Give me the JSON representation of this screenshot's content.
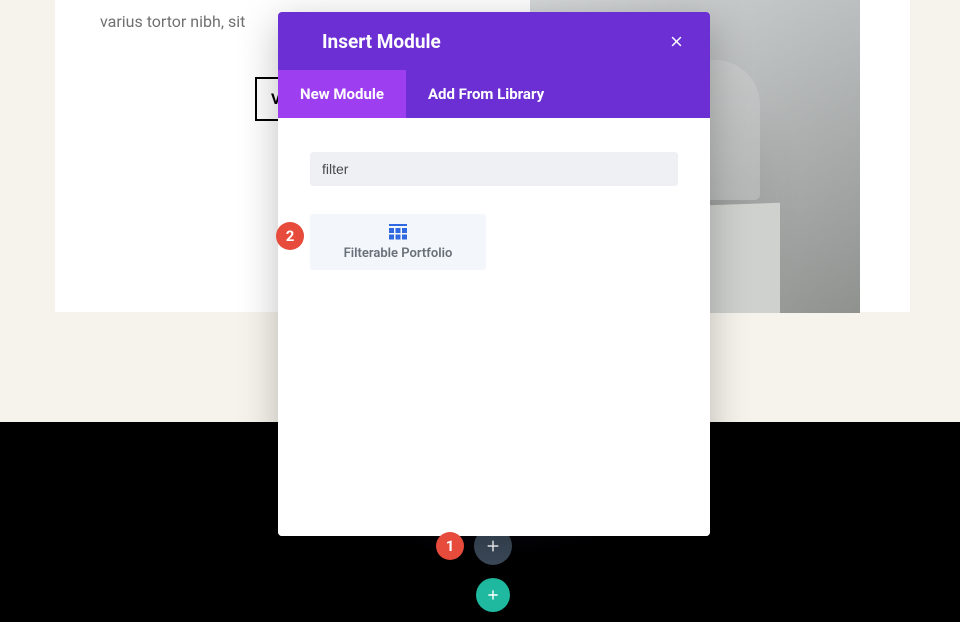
{
  "page": {
    "body_text": "varius tortor nibh, sit",
    "button_label": "V"
  },
  "modal": {
    "title": "Insert Module",
    "tabs": {
      "new": "New Module",
      "library": "Add From Library"
    },
    "search": {
      "value": "filter",
      "placeholder": ""
    },
    "module": {
      "label": "Filterable Portfolio"
    }
  },
  "annotations": {
    "one": "1",
    "two": "2"
  }
}
